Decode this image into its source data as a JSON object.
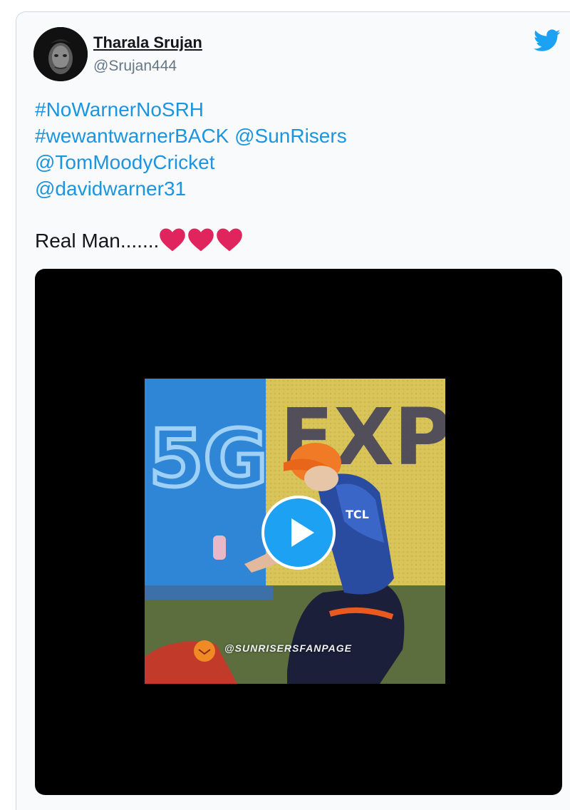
{
  "author": {
    "name": "Tharala Srujan",
    "handle": "@Srujan444"
  },
  "tweet": {
    "links": [
      "#NoWarnerNoSRH",
      "#wewantwarnerBACK @SunRisers",
      "@TomMoodyCricket",
      "@davidwarner31"
    ],
    "body_text": "Real Man.......",
    "emoji": [
      "red-heart",
      "red-heart",
      "red-heart"
    ]
  },
  "media": {
    "type": "video",
    "watermark": "@SUNRISERSFANPAGE",
    "frame_text": [
      "5G",
      "EXPO",
      "TCL"
    ]
  },
  "icons": {
    "brand": "twitter-bird-icon",
    "play": "play-icon"
  },
  "colors": {
    "link": "#1b95e0",
    "brand": "#1da1f2",
    "heart": "#e0245e",
    "media_bg": "#000000"
  }
}
